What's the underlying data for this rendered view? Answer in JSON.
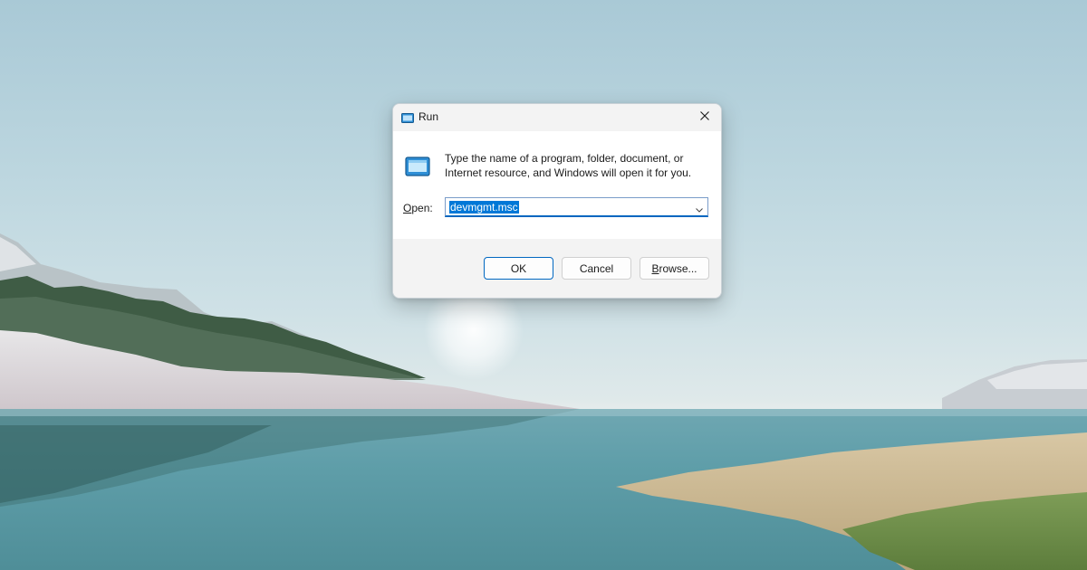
{
  "dialog": {
    "title": "Run",
    "description": "Type the name of a program, folder, document, or Internet resource, and Windows will open it for you.",
    "open_label_accel": "O",
    "open_label_rest": "pen:",
    "command_value": "devmgmt.msc",
    "buttons": {
      "ok": "OK",
      "cancel": "Cancel",
      "browse_accel": "B",
      "browse_rest": "rowse..."
    },
    "icons": {
      "title": "run-icon",
      "body": "run-icon",
      "close": "close-icon",
      "dropdown": "chevron-down-icon"
    }
  },
  "colors": {
    "accent": "#0067c0",
    "selection": "#0078d7",
    "dialog_bg": "#f3f3f3",
    "content_bg": "#ffffff"
  }
}
